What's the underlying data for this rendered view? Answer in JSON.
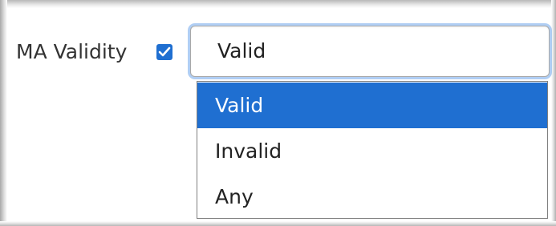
{
  "field": {
    "label": "MA Validity",
    "checkbox_checked": true,
    "checkbox_color": "#1f6fd1"
  },
  "select": {
    "value": "Valid",
    "options": [
      {
        "label": "Valid",
        "selected": true
      },
      {
        "label": "Invalid",
        "selected": false
      },
      {
        "label": "Any",
        "selected": false
      }
    ],
    "highlight_color": "#1f6fd1"
  }
}
